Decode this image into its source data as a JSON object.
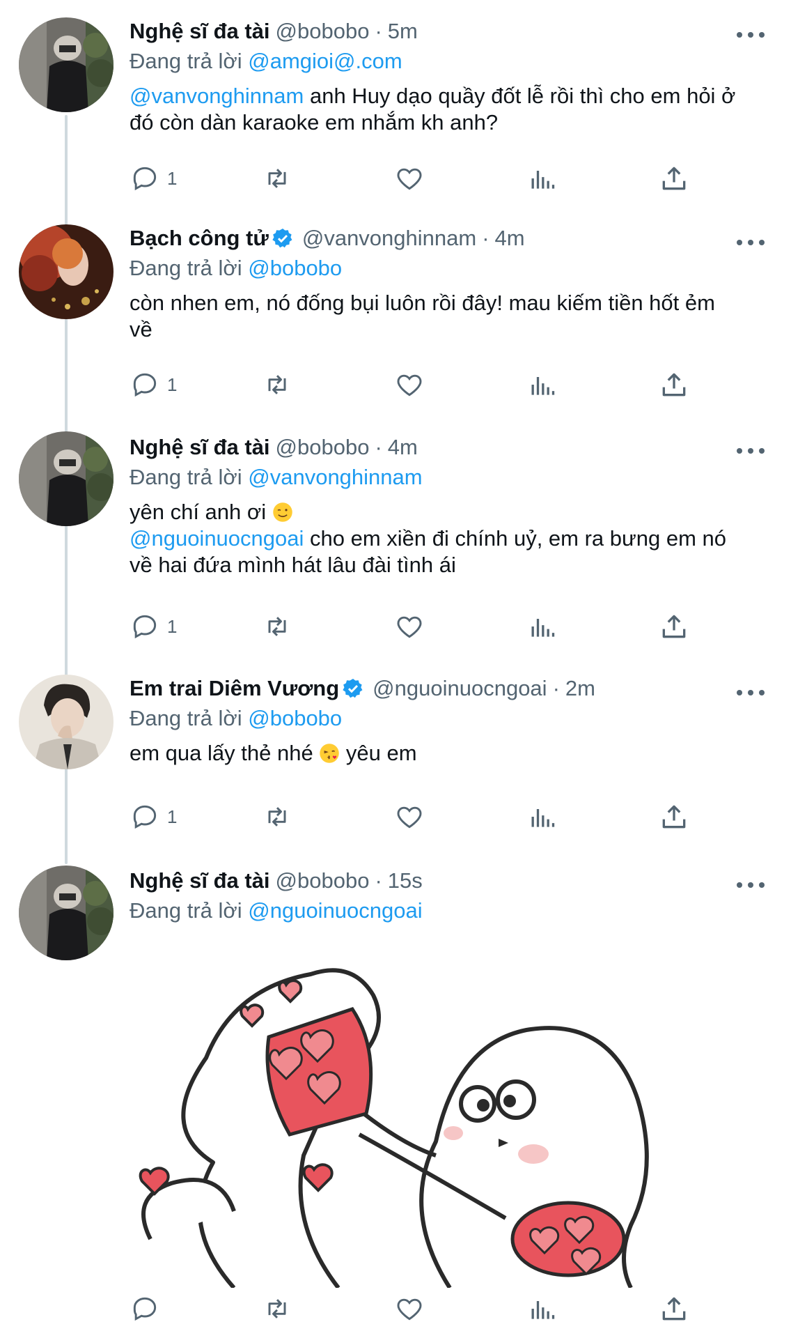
{
  "reply_prefix": "Đang trả lời",
  "tweets": [
    {
      "name": "Nghệ sĩ đa tài",
      "verified": false,
      "handle": "@bobobo",
      "time": "5m",
      "reply_to": "@amgioi@.com",
      "body": [
        {
          "mention": "@vanvonghinnam",
          "text": " anh Huy dạo quầy đốt lễ rồi thì cho em hỏi ở"
        },
        {
          "mention": "",
          "text": "đó còn dàn karaoke em nhắm kh anh?"
        }
      ],
      "reply_count": "1"
    },
    {
      "name": "Bạch công tử",
      "verified": true,
      "handle": "@vanvonghinnam",
      "time": "4m",
      "reply_to": "@bobobo",
      "body": [
        {
          "mention": "",
          "text": "còn nhen em, nó đống bụi luôn rồi đây! mau kiếm tiền hốt ẻm"
        },
        {
          "mention": "",
          "text": "về"
        }
      ],
      "reply_count": "1"
    },
    {
      "name": "Nghệ sĩ đa tài",
      "verified": false,
      "handle": "@bobobo",
      "time": "4m",
      "reply_to": "@vanvonghinnam",
      "body": [
        {
          "mention": "",
          "text": "yên chí anh ơi",
          "emoji": "wink-emoji"
        },
        {
          "mention": "@nguoinuocngoai",
          "text": " cho em xiền đi chính uỷ, em ra bưng em nó"
        },
        {
          "mention": "",
          "text": "về hai đứa mình hát lâu đài tình ái"
        }
      ],
      "reply_count": "1"
    },
    {
      "name": "Em trai Diêm Vương",
      "verified": true,
      "handle": "@nguoinuocngoai",
      "time": "2m",
      "reply_to": "@bobobo",
      "body": [
        {
          "mention": "",
          "text": "em qua lấy thẻ nhé",
          "emoji": "kiss-emoji",
          "after": " yêu em"
        }
      ],
      "reply_count": "1"
    },
    {
      "name": "Nghệ sĩ đa tài",
      "verified": false,
      "handle": "@bobobo",
      "time": "15s",
      "reply_to": "@nguoinuocngoai",
      "body": [],
      "reply_count": ""
    }
  ],
  "colors": {
    "accent": "#1d9bf0",
    "secondary_text": "#536471",
    "thread_line": "#cfd9de",
    "heart_red": "#e8545d"
  },
  "icons": [
    "reply-icon",
    "retweet-icon",
    "like-icon",
    "analytics-icon",
    "share-icon",
    "more-icon",
    "verified-icon"
  ]
}
